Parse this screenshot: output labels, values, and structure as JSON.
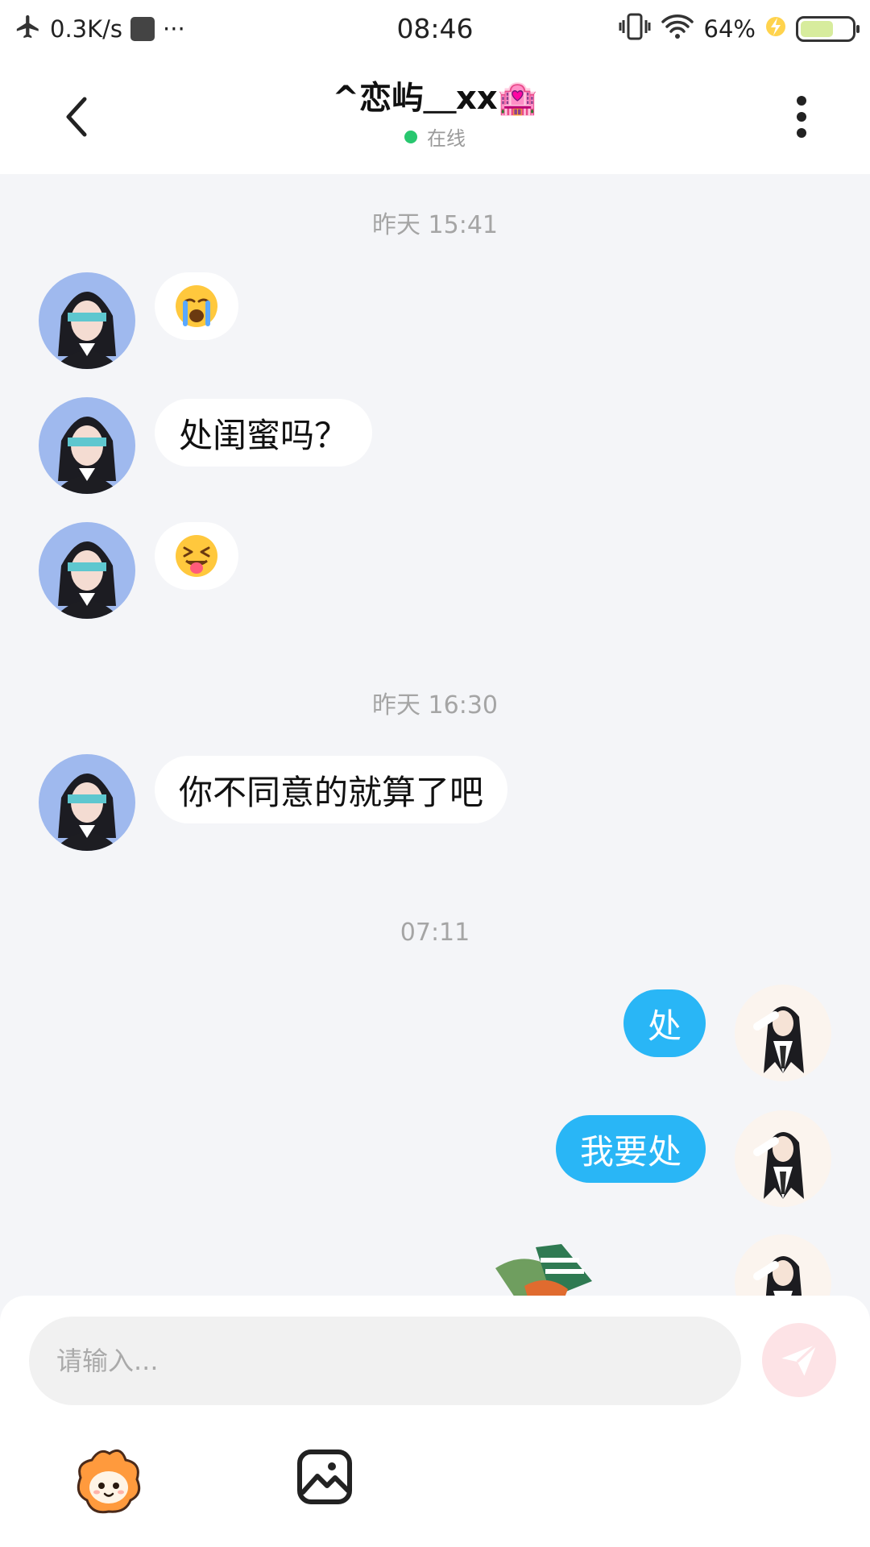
{
  "status_bar": {
    "net_speed": "0.3K/s",
    "more": "···",
    "time": "08:46",
    "battery_percent": "64%",
    "battery_level": 0.64
  },
  "header": {
    "title": "^恋屿＿xx🏩",
    "presence": "在线"
  },
  "messages": {
    "ts1": "昨天 15:41",
    "m1_emoji": "😭",
    "m2_text": "处闺蜜吗？",
    "m3_emoji": "😝",
    "ts2": "昨天 16:30",
    "m4_text": "你不同意的就算了吧",
    "ts3": "07:11",
    "m5_text": "处",
    "m6_text": "我要处"
  },
  "input": {
    "placeholder": "请输入..."
  },
  "colors": {
    "outgoing_bubble": "#29b6f6",
    "incoming_bubble": "#ffffff",
    "online": "#28c76f",
    "send_button": "#fde3e6"
  }
}
